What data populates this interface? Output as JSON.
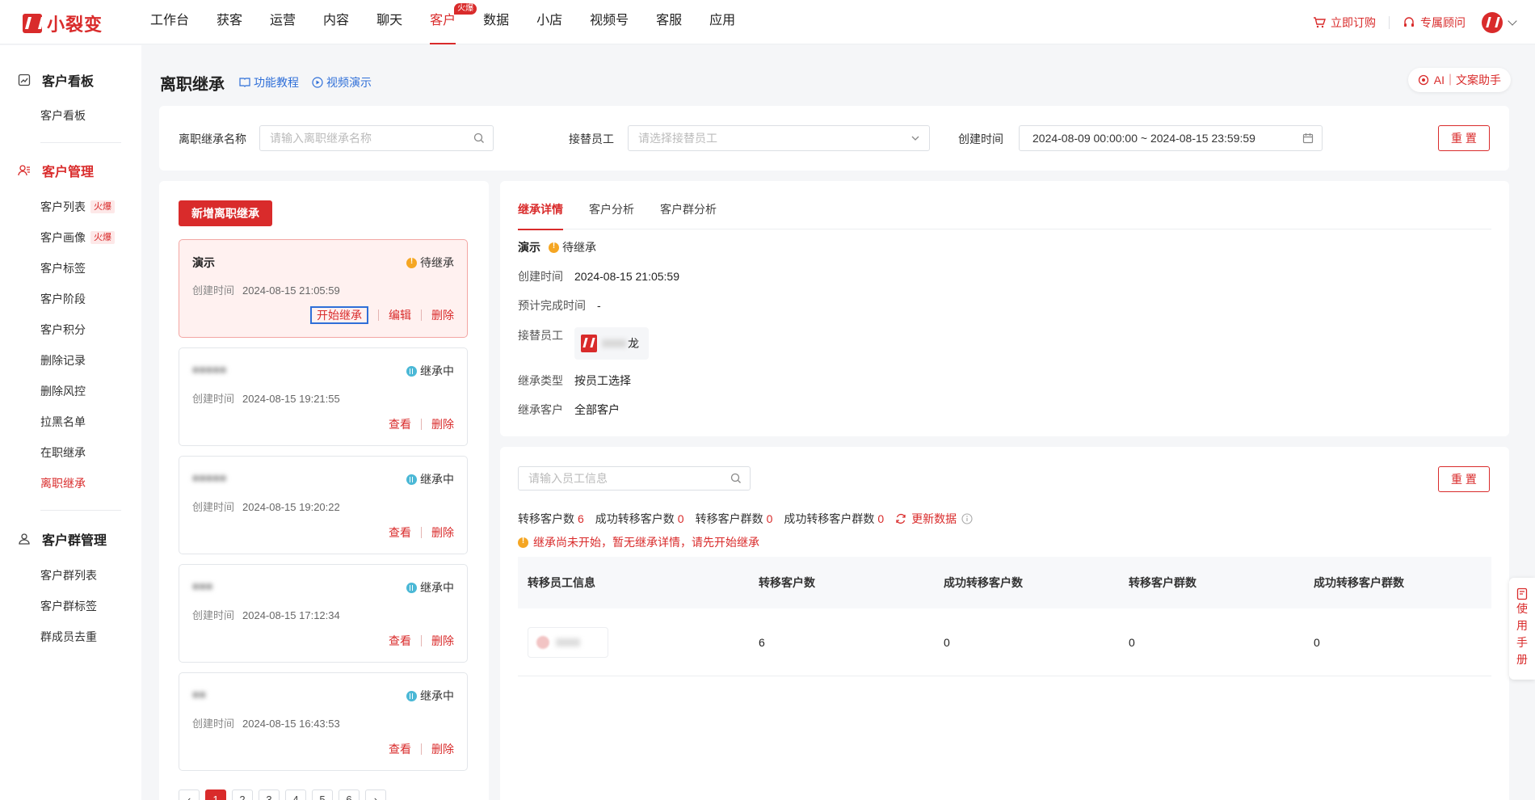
{
  "app": {
    "logo_text": "小裂变",
    "brand_color": "#d92b2b"
  },
  "nav": {
    "items": [
      "工作台",
      "获客",
      "运营",
      "内容",
      "聊天",
      "客户",
      "数据",
      "小店",
      "视频号",
      "客服",
      "应用"
    ],
    "active": "客户",
    "hot_badge": "火爆"
  },
  "topbar": {
    "order_label": "立即订购",
    "advisor_label": "专属顾问"
  },
  "sidebar": {
    "groups": [
      {
        "title": "客户看板",
        "items": [
          "客户看板"
        ]
      },
      {
        "title": "客户管理",
        "items": [
          "客户列表",
          "客户画像",
          "客户标签",
          "客户阶段",
          "客户积分",
          "删除记录",
          "删除风控",
          "拉黑名单",
          "在职继承",
          "离职继承"
        ]
      },
      {
        "title": "客户群管理",
        "items": [
          "客户群列表",
          "客户群标签",
          "群成员去重"
        ]
      }
    ],
    "hot_label": "火爆",
    "active_item": "离职继承"
  },
  "page": {
    "title": "离职继承",
    "tutorial_link": "功能教程",
    "video_link": "视频演示",
    "ai_button": "AI｜文案助手"
  },
  "filters": {
    "name_label": "离职继承名称",
    "name_placeholder": "请输入离职继承名称",
    "employee_label": "接替员工",
    "employee_placeholder": "请选择接替员工",
    "time_label": "创建时间",
    "time_value": "2024-08-09 00:00:00 ~ 2024-08-15 23:59:59",
    "reset_label": "重 置"
  },
  "list": {
    "new_button": "新增离职继承",
    "time_prefix": "创建时间",
    "entries": [
      {
        "name": "演示",
        "status": "待继承",
        "time": "2024-08-15 21:05:59",
        "actions": [
          "开始继承",
          "编辑",
          "删除"
        ]
      },
      {
        "name": "■■■■■",
        "status": "继承中",
        "time": "2024-08-15 19:21:55",
        "actions": [
          "查看",
          "删除"
        ]
      },
      {
        "name": "■■■■■",
        "status": "继承中",
        "time": "2024-08-15 19:20:22",
        "actions": [
          "查看",
          "删除"
        ]
      },
      {
        "name": "■■■",
        "status": "继承中",
        "time": "2024-08-15 17:12:34",
        "actions": [
          "查看",
          "删除"
        ]
      },
      {
        "name": "■■",
        "status": "继承中",
        "time": "2024-08-15 16:43:53",
        "actions": [
          "查看",
          "删除"
        ]
      }
    ],
    "pages": [
      "1",
      "2",
      "3",
      "4",
      "5",
      "6"
    ]
  },
  "detail": {
    "tabs": [
      "继承详情",
      "客户分析",
      "客户群分析"
    ],
    "name": "演示",
    "status": "待继承",
    "created_label": "创建时间",
    "created_value": "2024-08-15 21:05:59",
    "eta_label": "预计完成时间",
    "eta_value": "-",
    "employee_label": "接替员工",
    "employee_name": "龙",
    "type_label": "继承类型",
    "type_value": "按员工选择",
    "customers_label": "继承客户",
    "customers_value": "全部客户"
  },
  "stats": {
    "search_placeholder": "请输入员工信息",
    "reset_label": "重 置",
    "items": [
      {
        "label": "转移客户数",
        "value": "6"
      },
      {
        "label": "成功转移客户数",
        "value": "0"
      },
      {
        "label": "转移客户群数",
        "value": "0"
      },
      {
        "label": "成功转移客户群数",
        "value": "0"
      }
    ],
    "refresh_label": "更新数据",
    "warning": "继承尚未开始，暂无继承详情，请先开始继承",
    "table": {
      "headers": [
        "转移员工信息",
        "转移客户数",
        "成功转移客户数",
        "转移客户群数",
        "成功转移客户群数"
      ],
      "rows": [
        {
          "c2": "6",
          "c3": "0",
          "c4": "0",
          "c5": "0"
        }
      ]
    }
  },
  "manual_tab": [
    "使",
    "用",
    "手",
    "册"
  ]
}
